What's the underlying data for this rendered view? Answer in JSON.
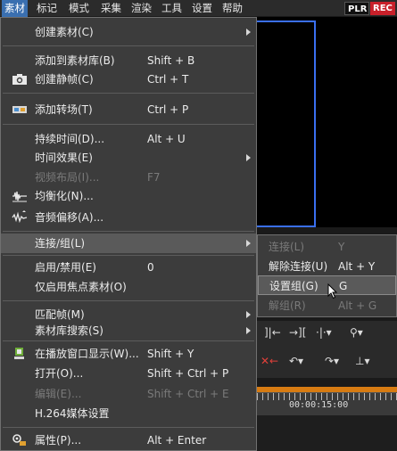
{
  "menubar": {
    "items": [
      "素材",
      "标记",
      "模式",
      "采集",
      "渲染",
      "工具",
      "设置",
      "帮助"
    ],
    "badges": {
      "plr": "PLR",
      "rec": "REC"
    }
  },
  "menu": {
    "items": [
      {
        "label": "创建素材(C)",
        "shortcut": "",
        "submenu": true,
        "icon": ""
      },
      {
        "label": "添加到素材库(B)",
        "shortcut": "Shift + B",
        "icon": ""
      },
      {
        "label": "创建静帧(C)",
        "shortcut": "Ctrl + T",
        "icon": "camera-icon"
      },
      {
        "label": "添加转场(T)",
        "shortcut": "Ctrl + P",
        "icon": "transition-icon"
      },
      {
        "label": "持续时间(D)...",
        "shortcut": "Alt + U",
        "icon": ""
      },
      {
        "label": "时间效果(E)",
        "shortcut": "",
        "submenu": true,
        "icon": ""
      },
      {
        "label": "视频布局(I)...",
        "shortcut": "F7",
        "disabled": true,
        "icon": ""
      },
      {
        "label": "均衡化(N)...",
        "shortcut": "",
        "icon": "equalizer-icon"
      },
      {
        "label": "音频偏移(A)...",
        "shortcut": "",
        "icon": "audio-offset-icon"
      },
      {
        "label": "连接/组(L)",
        "shortcut": "",
        "submenu": true,
        "highlighted": true,
        "icon": ""
      },
      {
        "label": "启用/禁用(E)",
        "shortcut": "0",
        "icon": ""
      },
      {
        "label": "仅启用焦点素材(O)",
        "shortcut": "",
        "icon": ""
      },
      {
        "label": "匹配帧(M)",
        "shortcut": "",
        "submenu": true,
        "icon": ""
      },
      {
        "label": "素材库搜索(S)",
        "shortcut": "",
        "submenu": true,
        "icon": ""
      },
      {
        "label": "在播放窗口显示(W)...",
        "shortcut": "Shift + Y",
        "icon": "player-window-icon"
      },
      {
        "label": "打开(O)...",
        "shortcut": "Shift + Ctrl + P",
        "icon": ""
      },
      {
        "label": "编辑(E)...",
        "shortcut": "Shift + Ctrl + E",
        "disabled": true,
        "icon": ""
      },
      {
        "label": "H.264媒体设置",
        "shortcut": "",
        "icon": ""
      },
      {
        "label": "属性(P)...",
        "shortcut": "Alt + Enter",
        "icon": "properties-icon"
      }
    ]
  },
  "submenu": {
    "items": [
      {
        "label": "连接(L)",
        "shortcut": "Y",
        "disabled": true
      },
      {
        "label": "解除连接(U)",
        "shortcut": "Alt + Y"
      },
      {
        "label": "设置组(G)",
        "shortcut": "G",
        "highlighted": true
      },
      {
        "label": "解组(R)",
        "shortcut": "Alt + G",
        "disabled": true
      }
    ]
  },
  "timeline": {
    "timecode": "00:00:15:00"
  },
  "colors": {
    "accent": "#3a6fb0",
    "rec": "#c8202a",
    "timeline_bar": "#d77b12",
    "preview_border": "#3a6ff0"
  }
}
